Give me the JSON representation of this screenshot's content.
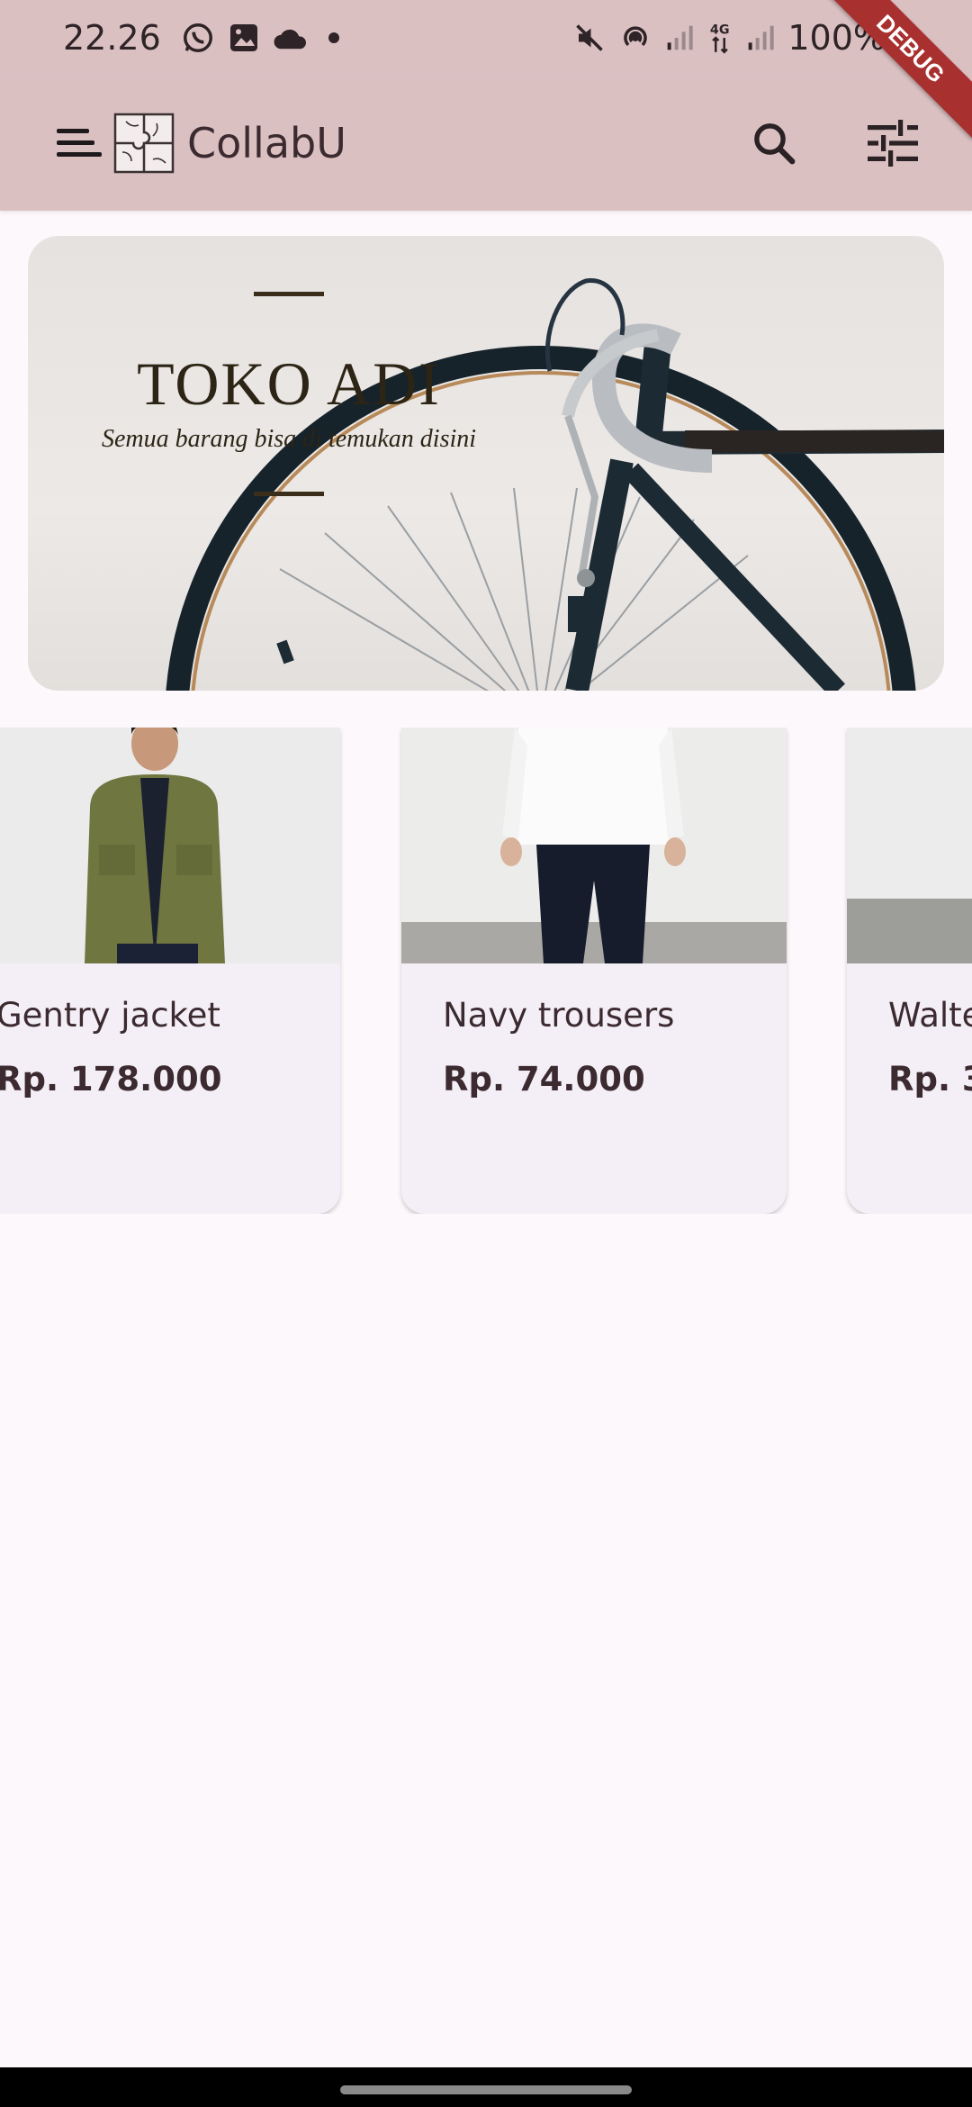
{
  "status_bar": {
    "time": "22.26",
    "battery": "100%",
    "notifications": [
      "whatsapp-icon",
      "gallery-icon",
      "cloud-icon"
    ],
    "system_icons": [
      "mute-icon",
      "hotspot-icon",
      "signal-icon",
      "4g-icon",
      "signal-icon",
      "battery-icon"
    ]
  },
  "app_bar": {
    "title": "CollabU",
    "debug_label": "DEBUG"
  },
  "banner": {
    "title": "TOKO ADI",
    "subtitle": "Semua barang bisa di temukan disini"
  },
  "products": [
    {
      "name": "Gentry jacket",
      "price": "Rp. 178.000"
    },
    {
      "name": "Navy trousers",
      "price": "Rp. 74.000"
    },
    {
      "name": "Walte",
      "price": "Rp. 3"
    }
  ],
  "colors": {
    "app_bar_bg": "#dbc0c2",
    "page_bg": "#fdf8fb",
    "card_bg": "#f4eff6",
    "text": "#3b2a2f"
  }
}
